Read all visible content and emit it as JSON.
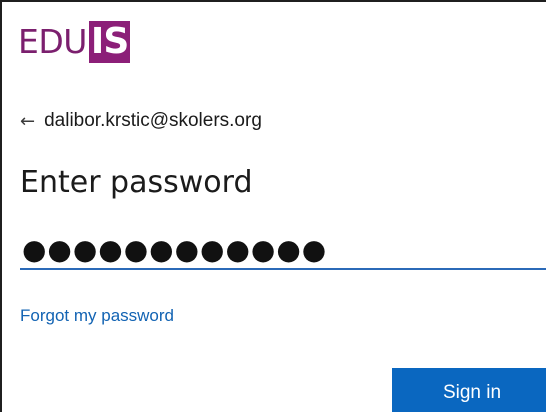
{
  "logo": {
    "text": "EDU",
    "box_text": "IS",
    "text_color": "#7b1f6e",
    "box_color": "#8c1f78"
  },
  "identity": {
    "back_icon": "left-arrow-icon",
    "back_glyph": "←",
    "email": "dalibor.krstic@skolers.org"
  },
  "title": "Enter password",
  "password": {
    "value": "●●●●●●●●●●●●",
    "underline_color": "#2b6ab8"
  },
  "forgot_link": "Forgot my password",
  "sign_in_button": {
    "label": "Sign in",
    "color": "#0a67c0"
  }
}
